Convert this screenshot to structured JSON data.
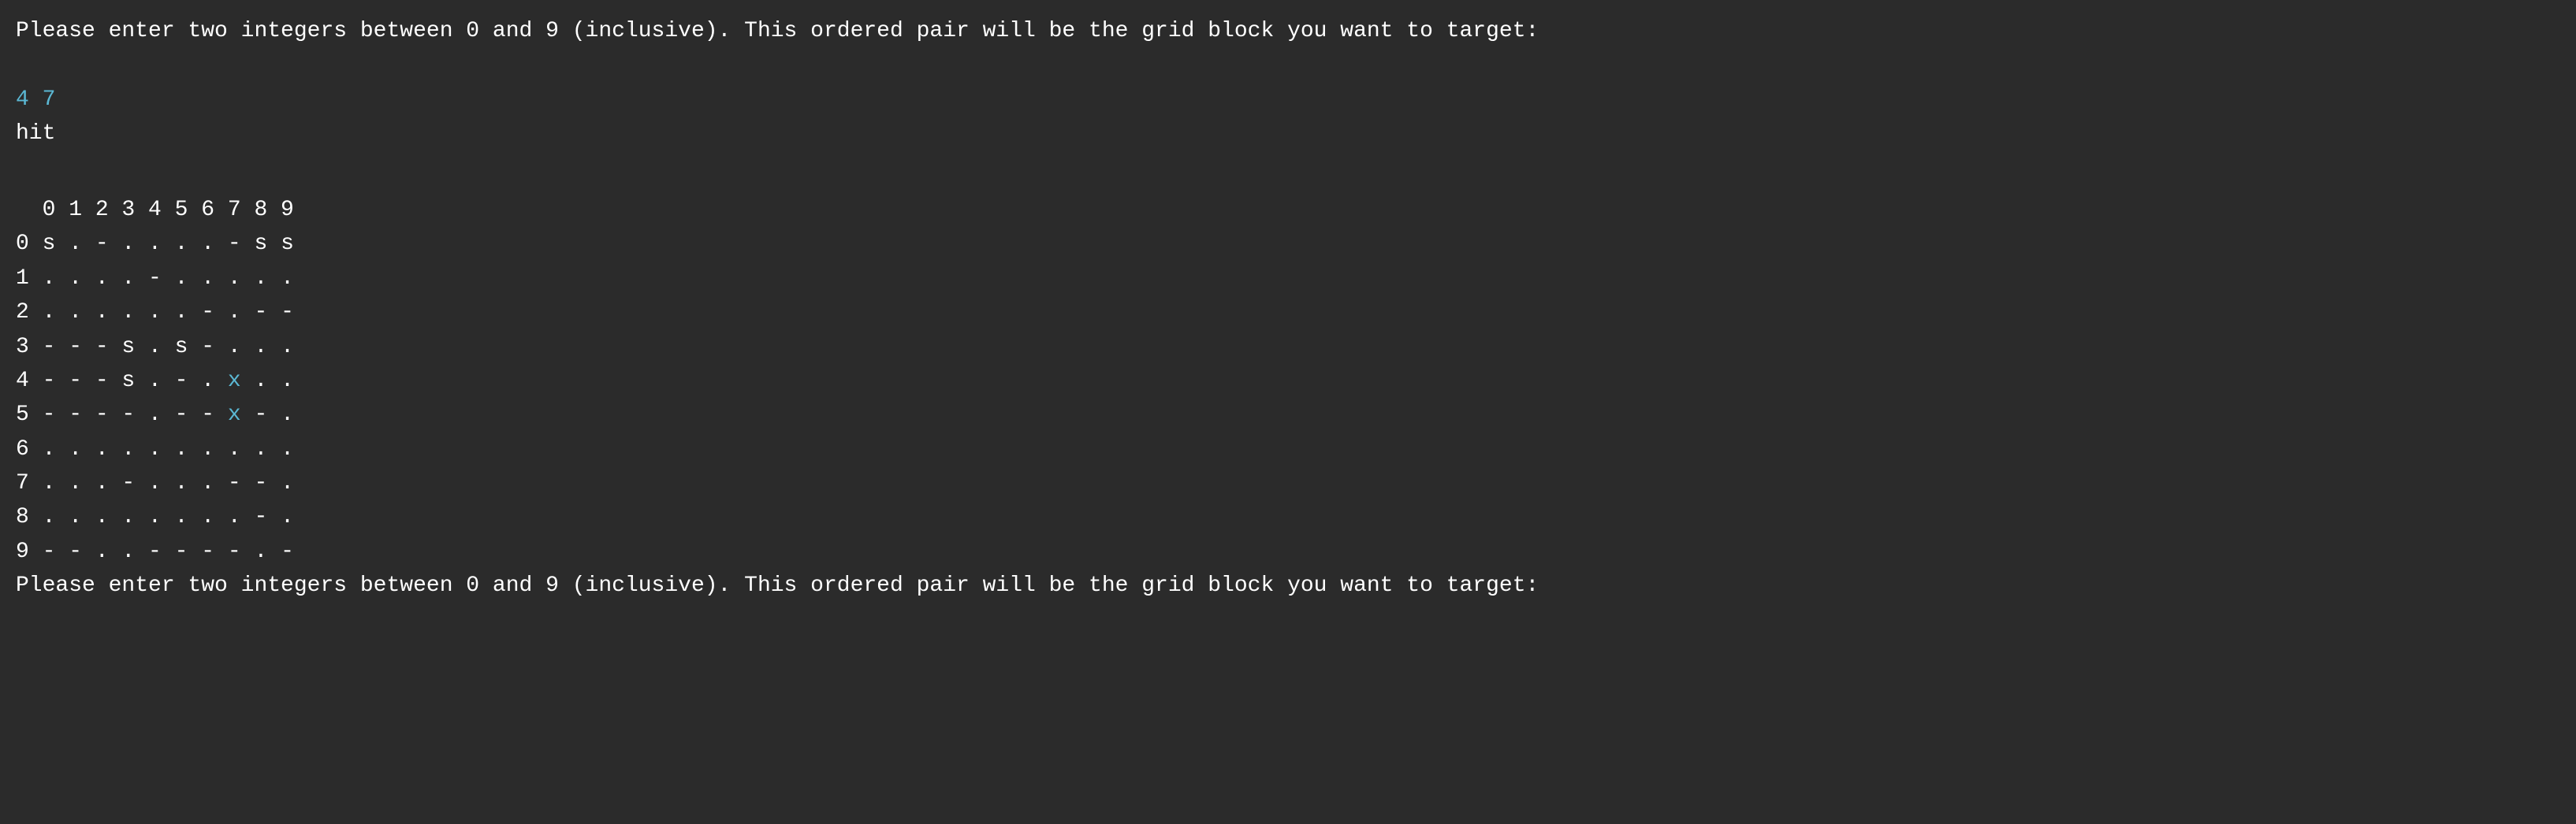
{
  "terminal": {
    "prompt1": "Please enter two integers between 0 and 9 (inclusive). This ordered pair will be the grid block you want to target:",
    "user_input": "4 7",
    "hit_result": "hit",
    "grid_header": "  0 1 2 3 4 5 6 7 8 9",
    "grid_rows": [
      {
        "label": "0",
        "cells": " s . - . . . . - s s"
      },
      {
        "label": "1",
        "cells": " . . . . - . . . . ."
      },
      {
        "label": "2",
        "cells": " . . . . . . - . - -"
      },
      {
        "label": "3",
        "cells": " - - - s . s - . . ."
      },
      {
        "label": "4",
        "cells": " - - - s . - . x . ."
      },
      {
        "label": "5",
        "cells": " - - - - . - - x - ."
      },
      {
        "label": "6",
        "cells": " . . . . . . . . . ."
      },
      {
        "label": "7",
        "cells": " . . . - . . . - - ."
      },
      {
        "label": "8",
        "cells": " . . . . . . . . - ."
      },
      {
        "label": "9",
        "cells": " - - . . - - - - . -"
      }
    ],
    "prompt2": "Please enter two integers between 0 and 9 (inclusive). This ordered pair will be the grid block you want to target:"
  }
}
